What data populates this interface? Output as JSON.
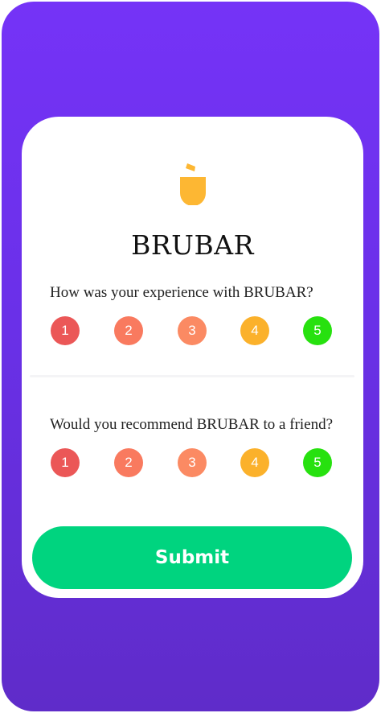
{
  "app": {
    "brand": "BRUBAR"
  },
  "questions": [
    {
      "text": "How was your experience with BRUBAR?",
      "options": [
        {
          "label": "1",
          "color": "#eb5757"
        },
        {
          "label": "2",
          "color": "#f97a5f"
        },
        {
          "label": "3",
          "color": "#fb8a63"
        },
        {
          "label": "4",
          "color": "#fbb12b"
        },
        {
          "label": "5",
          "color": "#27e10f"
        }
      ]
    },
    {
      "text": "Would you recommend BRUBAR to a friend?",
      "options": [
        {
          "label": "1",
          "color": "#eb5757"
        },
        {
          "label": "2",
          "color": "#f97a5f"
        },
        {
          "label": "3",
          "color": "#fb8a63"
        },
        {
          "label": "4",
          "color": "#fbb12b"
        },
        {
          "label": "5",
          "color": "#27e10f"
        }
      ]
    }
  ],
  "submit_label": "Submit",
  "colors": {
    "background_top": "#7533f7",
    "background_bottom": "#5f2cc9",
    "logo": "#fdb733",
    "submit": "#00d47f"
  },
  "icons": {
    "logo": "cup-logo-icon"
  }
}
